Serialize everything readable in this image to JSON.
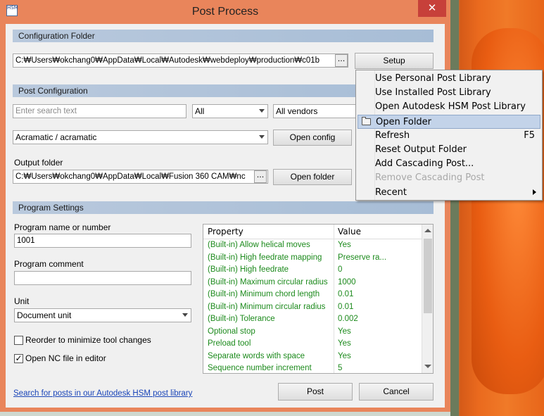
{
  "window": {
    "title": "Post Process",
    "icon_text": "HSM",
    "close_glyph": "✕"
  },
  "config_folder": {
    "header": "Configuration Folder",
    "path": "C:₩Users₩okchang0₩AppData₩Local₩Autodesk₩webdeploy₩production₩c01b",
    "browse_label": "...",
    "setup_label": "Setup"
  },
  "post_config": {
    "header": "Post Configuration",
    "search_placeholder": "Enter search text",
    "filter_value": "All",
    "vendor_value": "All vendors",
    "post_value": "Acramatic / acramatic",
    "open_config_label": "Open config",
    "output_folder_label": "Output folder",
    "output_path": "C:₩Users₩okchang0₩AppData₩Local₩Fusion 360 CAM₩nc",
    "output_browse_label": "...",
    "open_folder_label": "Open folder"
  },
  "program_settings": {
    "header": "Program Settings",
    "name_label": "Program name or number",
    "name_value": "1001",
    "comment_label": "Program comment",
    "comment_value": "",
    "unit_label": "Unit",
    "unit_value": "Document unit",
    "reorder_label": "Reorder to minimize tool changes",
    "reorder_checked": false,
    "open_nc_label": "Open NC file in editor",
    "open_nc_checked": true,
    "check_glyph": "✓"
  },
  "property_grid": {
    "col_property": "Property",
    "col_value": "Value",
    "rows": [
      {
        "property": "(Built-in) Allow helical moves",
        "value": "Yes"
      },
      {
        "property": "(Built-in) High feedrate mapping",
        "value": "Preserve ra..."
      },
      {
        "property": "(Built-in) High feedrate",
        "value": "0"
      },
      {
        "property": "(Built-in) Maximum circular radius",
        "value": "1000"
      },
      {
        "property": "(Built-in) Minimum chord length",
        "value": "0.01"
      },
      {
        "property": "(Built-in) Minimum circular radius",
        "value": "0.01"
      },
      {
        "property": "(Built-in) Tolerance",
        "value": "0.002"
      },
      {
        "property": "Optional stop",
        "value": "Yes"
      },
      {
        "property": "Preload tool",
        "value": "Yes"
      },
      {
        "property": "Separate words with space",
        "value": "Yes"
      },
      {
        "property": "Sequence number increment",
        "value": "5"
      }
    ]
  },
  "footer": {
    "search_link": "Search for posts in our Autodesk HSM post library",
    "post_label": "Post",
    "cancel_label": "Cancel"
  },
  "context_menu": {
    "items": [
      {
        "label": "Use Personal Post Library",
        "shortcut": "",
        "state": "normal"
      },
      {
        "label": "Use Installed Post Library",
        "shortcut": "",
        "state": "normal"
      },
      {
        "label": "Open Autodesk HSM Post Library",
        "shortcut": "",
        "state": "normal"
      },
      {
        "label": "Open Folder",
        "shortcut": "",
        "state": "highlighted",
        "icon": "folder-icon"
      },
      {
        "label": "Refresh",
        "shortcut": "F5",
        "state": "normal"
      },
      {
        "label": "Reset Output Folder",
        "shortcut": "",
        "state": "normal"
      },
      {
        "label": "Add Cascading Post...",
        "shortcut": "",
        "state": "normal"
      },
      {
        "label": "Remove Cascading Post",
        "shortcut": "",
        "state": "disabled"
      },
      {
        "label": "Recent",
        "shortcut": "",
        "state": "normal",
        "submenu": true
      }
    ]
  },
  "colors": {
    "window_frame": "#e9855b",
    "section_header": "#b9c9dd",
    "property_text": "#1c8a1c",
    "link": "#1a45b8",
    "close_button": "#c7403a",
    "menu_highlight": "#c3d3e9"
  }
}
